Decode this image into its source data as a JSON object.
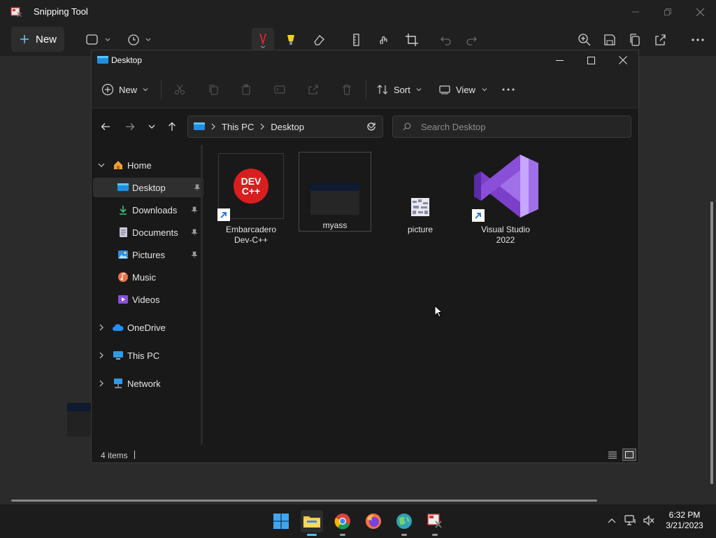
{
  "snipping_tool": {
    "title": "Snipping Tool",
    "new_label": "New"
  },
  "explorer": {
    "title": "Desktop",
    "cmdbar": {
      "new_label": "New",
      "sort_label": "Sort",
      "view_label": "View"
    },
    "address": {
      "root": "This PC",
      "current": "Desktop"
    },
    "search_placeholder": "Search Desktop",
    "sidebar": {
      "home": "Home",
      "items": [
        {
          "label": "Desktop",
          "icon": "desktop-icon",
          "pinned": true
        },
        {
          "label": "Downloads",
          "icon": "download-icon",
          "pinned": true
        },
        {
          "label": "Documents",
          "icon": "document-icon",
          "pinned": true
        },
        {
          "label": "Pictures",
          "icon": "pictures-icon",
          "pinned": true
        },
        {
          "label": "Music",
          "icon": "music-icon",
          "pinned": false
        },
        {
          "label": "Videos",
          "icon": "videos-icon",
          "pinned": false
        }
      ],
      "onedrive": "OneDrive",
      "thispc": "This PC",
      "network": "Network"
    },
    "files": [
      {
        "name": "Embarcadero Dev-C++",
        "line1": "Embarcadero",
        "line2": "Dev-C++",
        "icon": "devcpp-icon",
        "shortcut": true,
        "badge": "DEV C++"
      },
      {
        "name": "myass",
        "line1": "myass",
        "line2": "",
        "icon": "folder-thumbnail-icon",
        "shortcut": false
      },
      {
        "name": "picture",
        "line1": "picture",
        "line2": "",
        "icon": "image-file-icon",
        "shortcut": false
      },
      {
        "name": "Visual Studio 2022",
        "line1": "Visual Studio",
        "line2": "2022",
        "icon": "visual-studio-icon",
        "shortcut": true
      }
    ],
    "status": "4 items"
  },
  "taskbar": {
    "time": "6:32 PM",
    "date": "3/21/2023"
  },
  "colors": {
    "accent": "#4cc2ff",
    "vs_purple": "#8a4fd8",
    "devcpp_red": "#d81e1e"
  }
}
